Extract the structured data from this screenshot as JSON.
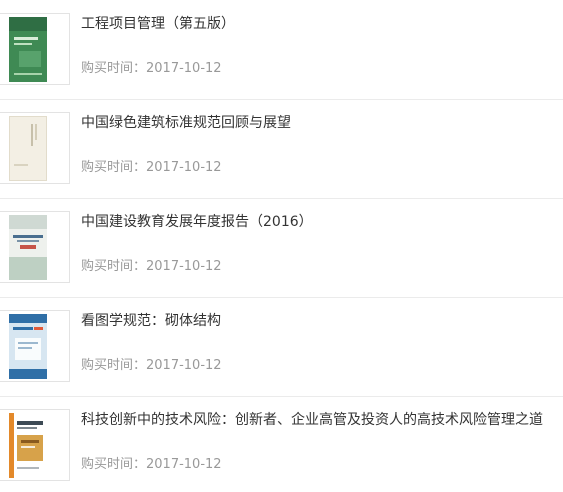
{
  "purchase_label": "购买时间：",
  "orders": [
    {
      "title": "工程项目管理（第五版）",
      "date": "2017-10-12",
      "cover_icon": "book-cover-green"
    },
    {
      "title": "中国绿色建筑标准规范回顾与展望",
      "date": "2017-10-12",
      "cover_icon": "book-cover-cream"
    },
    {
      "title": "中国建设教育发展年度报告（2016）",
      "date": "2017-10-12",
      "cover_icon": "book-cover-mist"
    },
    {
      "title": "看图学规范：砌体结构",
      "date": "2017-10-12",
      "cover_icon": "book-cover-blue"
    },
    {
      "title": "科技创新中的技术风险：创新者、企业高管及投资人的高技术风险管理之道",
      "date": "2017-10-12",
      "cover_icon": "book-cover-orange"
    }
  ],
  "colors": {
    "title_text": "#333333",
    "meta_text": "#999999",
    "divider": "#ebebeb"
  }
}
